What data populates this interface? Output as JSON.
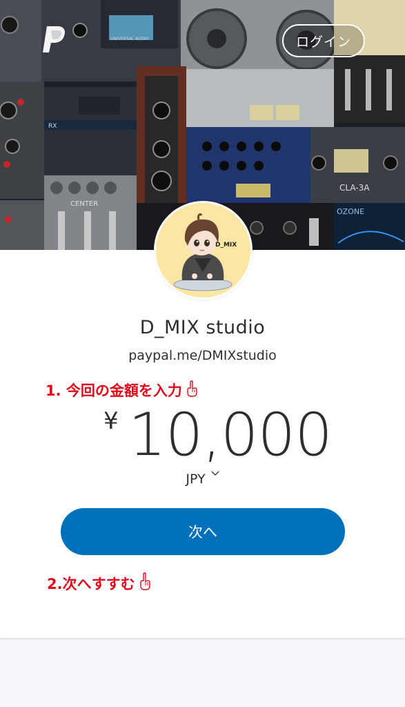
{
  "header": {
    "login_label": "ログイン"
  },
  "merchant": {
    "name": "D_MIX studio",
    "link": "paypal.me/DMIXstudio",
    "avatar_text": "D_MIX"
  },
  "annotations": {
    "step1": "1. 今回の金額を入力",
    "step2": "2.次へすすむ"
  },
  "amount": {
    "currency_symbol": "¥",
    "value": "10,000",
    "currency_code": "JPY"
  },
  "actions": {
    "next_label": "次へ"
  },
  "colors": {
    "primary_button": "#0070ba",
    "annotation": "#e0081a",
    "text": "#2c2e2f"
  },
  "icons": {
    "logo": "paypal-logo-icon",
    "hand": "pointing-hand-icon",
    "chevron": "chevron-down-icon"
  }
}
